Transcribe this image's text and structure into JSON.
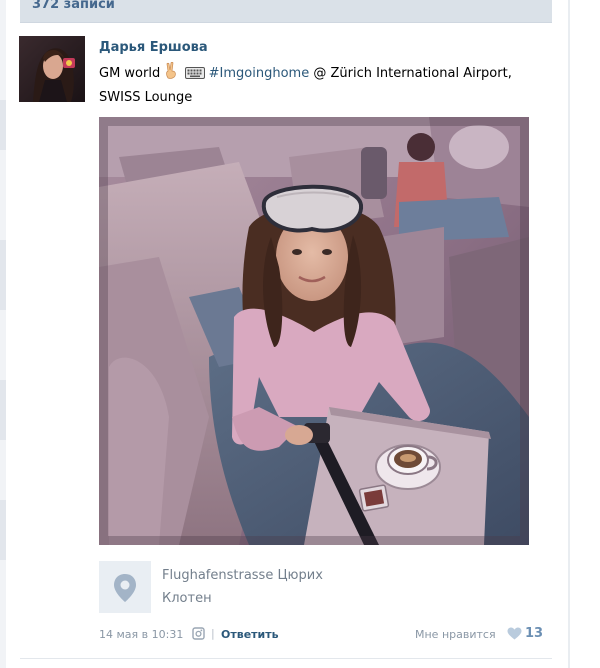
{
  "header": {
    "record_count": "372 записи"
  },
  "post": {
    "author": "Дарья Ершова",
    "text_pre": "GM world",
    "hashtag": "#Imgoinghome",
    "text_post": "@ Zürich International Airport, SWISS Lounge",
    "photo_description_icon": "airplane-seat-selfie-photo",
    "location": {
      "line1": "Flughafenstrasse Цюрих",
      "line2": "Клотен"
    },
    "footer": {
      "time": "14 мая в 10:31",
      "reply": "Ответить",
      "like_label": "Мне нравится",
      "like_count": "13"
    }
  },
  "colors": {
    "accent": "#2b587a",
    "header_bg": "#dae1e8",
    "muted": "#8a97a5"
  }
}
